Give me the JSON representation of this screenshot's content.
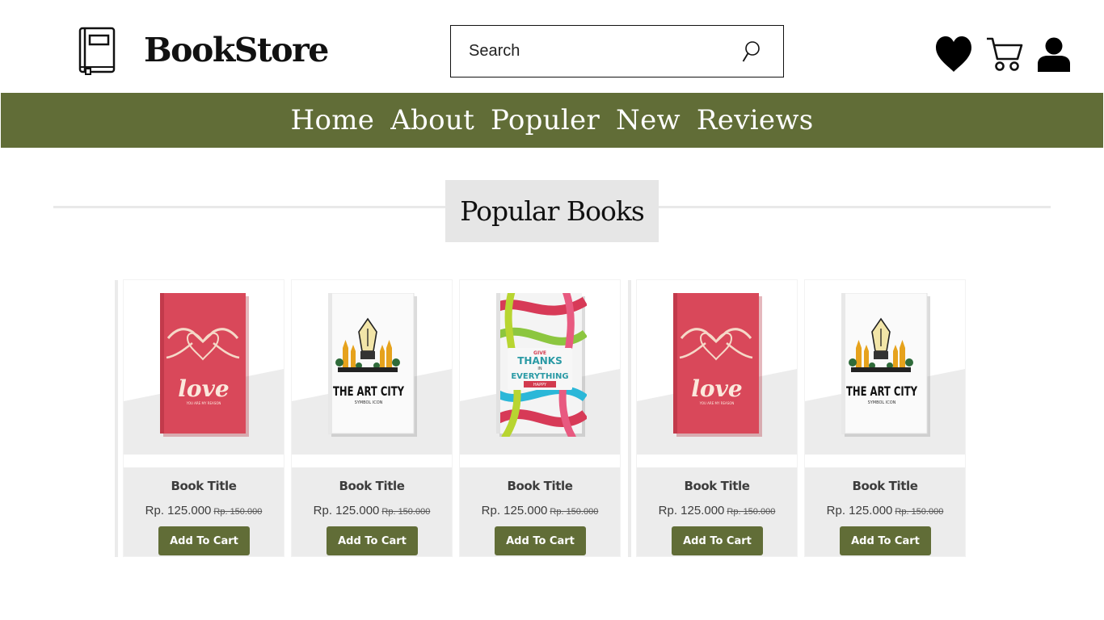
{
  "header": {
    "brand": "BookStore",
    "search_placeholder": "Search",
    "icons": [
      "book-icon",
      "search-icon",
      "heart-icon",
      "cart-icon",
      "user-icon"
    ]
  },
  "nav": {
    "items": [
      {
        "label": "Home"
      },
      {
        "label": "About"
      },
      {
        "label": "Populer"
      },
      {
        "label": "New"
      },
      {
        "label": "Reviews"
      }
    ]
  },
  "section": {
    "title": "Popular Books"
  },
  "books": [
    {
      "cover": "love",
      "title": "Book Title",
      "price": "Rp. 125.000",
      "old_price": "Rp. 150.000",
      "button": "Add To Cart"
    },
    {
      "cover": "art-city",
      "title": "Book Title",
      "price": "Rp. 125.000",
      "old_price": "Rp. 150.000",
      "button": "Add To Cart"
    },
    {
      "cover": "thanks",
      "title": "Book Title",
      "price": "Rp. 125.000",
      "old_price": "Rp. 150.000",
      "button": "Add To Cart"
    },
    {
      "cover": "love",
      "title": "Book Title",
      "price": "Rp. 125.000",
      "old_price": "Rp. 150.000",
      "button": "Add To Cart"
    },
    {
      "cover": "art-city",
      "title": "Book Title",
      "price": "Rp. 125.000",
      "old_price": "Rp. 150.000",
      "button": "Add To Cart"
    }
  ],
  "covers": {
    "love": {
      "word": "love",
      "tagline": "YOU ARE MY REASON"
    },
    "art-city": {
      "name": "THE ART CITY",
      "sub": "SYMBOL ICON"
    },
    "thanks": {
      "line1": "GIVE",
      "line2": "THANKS",
      "line3": "IN",
      "line4": "EVERYTHING",
      "line5": "HAPPY"
    }
  },
  "colors": {
    "accent": "#616d37",
    "love_cover": "#d9485a",
    "panel": "#ececec"
  }
}
